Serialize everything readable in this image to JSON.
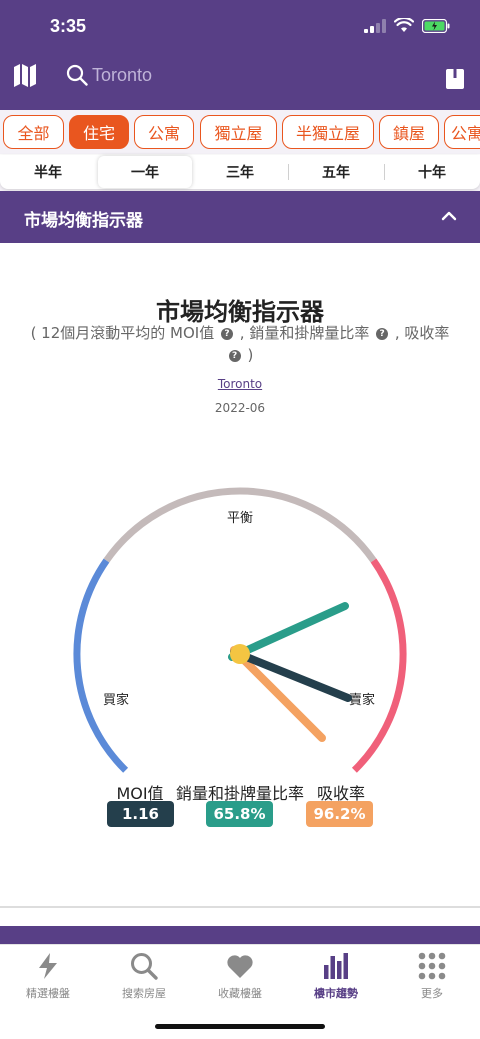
{
  "status": {
    "time": "3:35"
  },
  "search": {
    "placeholder": "Toronto"
  },
  "categories": [
    {
      "label": "全部",
      "active": false
    },
    {
      "label": "住宅",
      "active": true
    },
    {
      "label": "公寓",
      "active": false
    },
    {
      "label": "獨立屋",
      "active": false
    },
    {
      "label": "半獨立屋",
      "active": false
    },
    {
      "label": "鎮屋",
      "active": false
    },
    {
      "label": "公寓",
      "active": false
    }
  ],
  "periods": [
    {
      "label": "半年",
      "active": false
    },
    {
      "label": "一年",
      "active": true
    },
    {
      "label": "三年",
      "active": false
    },
    {
      "label": "五年",
      "active": false
    },
    {
      "label": "十年",
      "active": false
    }
  ],
  "section": {
    "title": "市場均衡指示器"
  },
  "gauge": {
    "title": "市場均衡指示器",
    "subtitle_part1": "( 12個月滾動平均的 MOI值",
    "subtitle_part2": ", 銷量和掛牌量比率",
    "subtitle_part3": ", 吸收率",
    "subtitle_part4": ")",
    "help_glyph": "?",
    "city": "Toronto",
    "date": "2022-06",
    "label_balance": "平衡",
    "label_buyer": "買家",
    "label_seller": "賣家",
    "colors": {
      "buyer": "#5b8ad8",
      "balance": "#c4baba",
      "seller": "#f0607a"
    }
  },
  "legend": [
    {
      "label": "MOI值",
      "value": "1.16",
      "color": "#243f4c"
    },
    {
      "label": "銷量和掛牌量比率",
      "value": "65.8%",
      "color": "#2a9d8a"
    },
    {
      "label": "吸收率",
      "value": "96.2%",
      "color": "#f4a261"
    }
  ],
  "tabbar": [
    {
      "label": "精選樓盤",
      "icon": "lightning-icon",
      "active": false
    },
    {
      "label": "搜索房屋",
      "icon": "search-icon",
      "active": false
    },
    {
      "label": "收藏樓盤",
      "icon": "heart-icon",
      "active": false
    },
    {
      "label": "樓市趨勢",
      "icon": "bar-chart-icon",
      "active": true
    },
    {
      "label": "更多",
      "icon": "grid-dots-icon",
      "active": false
    }
  ]
}
